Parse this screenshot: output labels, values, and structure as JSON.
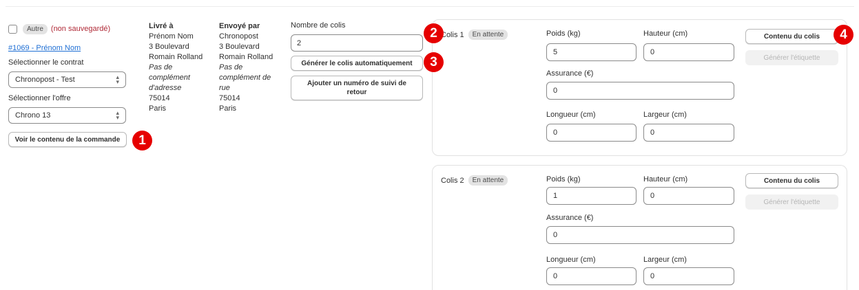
{
  "order": {
    "tag": "Autre",
    "unsaved": "(non sauvegardé)",
    "link": "#1069 - Prénom Nom",
    "contract_label": "Sélectionner le contrat",
    "contract_value": "Chronopost - Test",
    "offer_label": "Sélectionner l'offre",
    "offer_value": "Chrono 13",
    "view_button": "Voir le contenu de la commande"
  },
  "delivered_to": {
    "heading": "Livré à",
    "lines": [
      "Prénom Nom",
      "3 Boulevard",
      "Romain Rolland"
    ],
    "italic_lines": [
      "Pas de",
      "complément",
      "d'adresse"
    ],
    "postcode": "75014",
    "city": "Paris"
  },
  "sent_by": {
    "heading": "Envoyé par",
    "lines": [
      "Chronopost",
      "3 Boulevard",
      "Romain Rolland"
    ],
    "italic_lines": [
      "Pas de",
      "complément de",
      "rue"
    ],
    "postcode": "75014",
    "city": "Paris"
  },
  "packages_count": {
    "label": "Nombre de colis",
    "value": "2",
    "generate_button": "Générer le colis automatiquement",
    "return_button": "Ajouter un numéro de suivi de retour"
  },
  "labels": {
    "weight": "Poids (kg)",
    "height": "Hauteur (cm)",
    "insurance": "Assurance (€)",
    "length": "Longueur (cm)",
    "width": "Largeur (cm)",
    "content_button": "Contenu du colis",
    "label_button": "Générer l'étiquette"
  },
  "colis": [
    {
      "title": "Colis 1",
      "status": "En attente",
      "weight": "5",
      "height": "0",
      "insurance": "0",
      "length": "0",
      "width": "0"
    },
    {
      "title": "Colis 2",
      "status": "En attente",
      "weight": "1",
      "height": "0",
      "insurance": "0",
      "length": "0",
      "width": "0"
    }
  ],
  "badges": [
    "1",
    "2",
    "3",
    "4"
  ],
  "colors": {
    "badge": "#e60000",
    "link": "#1f6fd4",
    "unsaved": "#b02a37"
  }
}
